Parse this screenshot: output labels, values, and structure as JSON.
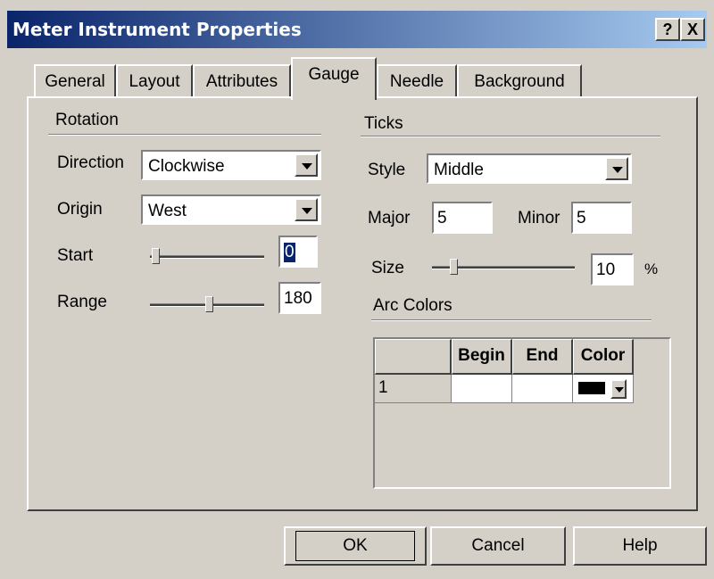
{
  "window": {
    "title": "Meter Instrument Properties",
    "help_glyph": "?",
    "close_glyph": "X"
  },
  "tabs": [
    "General",
    "Layout",
    "Attributes",
    "Gauge",
    "Needle",
    "Background"
  ],
  "rotation": {
    "group_label": "Rotation",
    "direction_label": "Direction",
    "direction_value": "Clockwise",
    "origin_label": "Origin",
    "origin_value": "West",
    "start_label": "Start",
    "start_value": "0",
    "range_label": "Range",
    "range_value": "180"
  },
  "ticks": {
    "group_label": "Ticks",
    "style_label": "Style",
    "style_value": "Middle",
    "major_label": "Major",
    "major_value": "5",
    "minor_label": "Minor",
    "minor_value": "5",
    "size_label": "Size",
    "size_value": "10",
    "size_unit": "%"
  },
  "arc_colors": {
    "group_label": "Arc Colors",
    "columns": [
      "Begin",
      "End",
      "Color"
    ],
    "rows": [
      {
        "index": "1",
        "begin": "",
        "end": "",
        "color": "#000000"
      }
    ]
  },
  "buttons": {
    "ok": "OK",
    "cancel": "Cancel",
    "help": "Help"
  }
}
